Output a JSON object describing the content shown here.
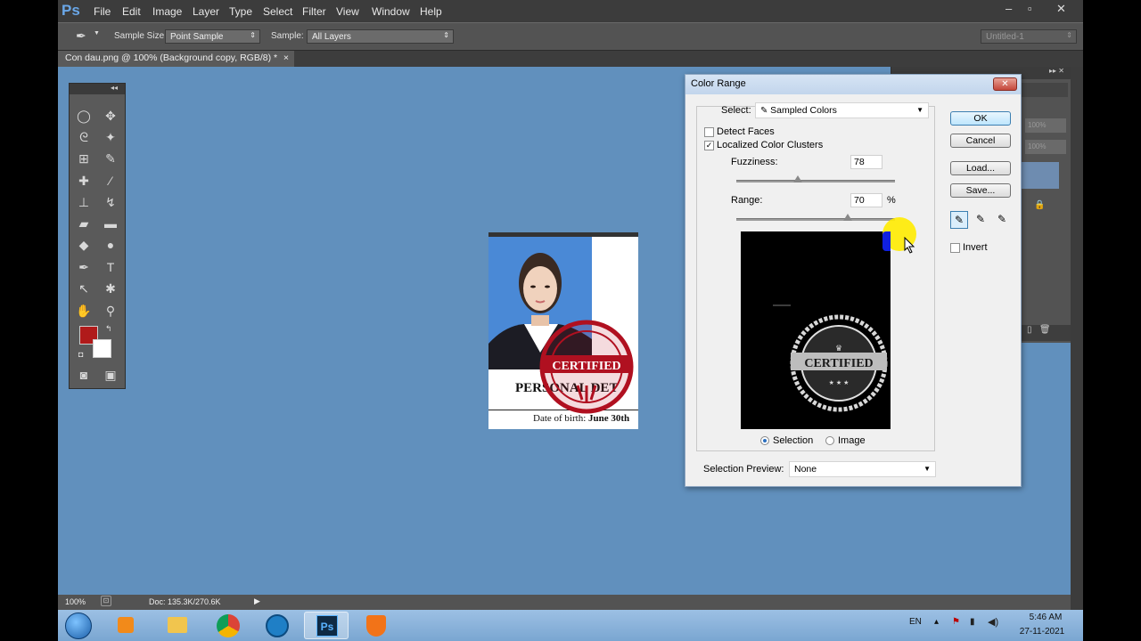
{
  "app": {
    "logo": "Ps",
    "menus": [
      "File",
      "Edit",
      "Image",
      "Layer",
      "Type",
      "Select",
      "Filter",
      "View",
      "Window",
      "Help"
    ],
    "window_controls": [
      "–",
      "▫",
      "✕"
    ]
  },
  "options_bar": {
    "sample_size_label": "Sample Size:",
    "sample_size_value": "Point Sample",
    "sample_label": "Sample:",
    "sample_value": "All Layers",
    "workspace_value": "Untitled-1"
  },
  "document_tab": {
    "title": "Con dau.png @ 100% (Background copy, RGB/8) *",
    "close": "×"
  },
  "document_image": {
    "heading": "PERSONAL DET",
    "dob_label": "Date of birth:",
    "dob_value": "June 30th",
    "stamp_text": "CERTIFIED"
  },
  "right_panel": {
    "zoom1": "100%",
    "zoom2": "100%"
  },
  "dialog": {
    "title": "Color Range",
    "close": "✕",
    "select_label": "Select:",
    "select_value": "Sampled Colors",
    "detect_faces": {
      "label": "Detect Faces",
      "checked": false
    },
    "localized_clusters": {
      "label": "Localized Color Clusters",
      "checked": true
    },
    "fuzziness_label": "Fuzziness:",
    "fuzziness_value": "78",
    "range_label": "Range:",
    "range_value": "70",
    "range_unit": "%",
    "preview_stamp_text": "CERTIFIED",
    "radio_selection": "Selection",
    "radio_image": "Image",
    "selection_preview_label": "Selection Preview:",
    "selection_preview_value": "None",
    "buttons": {
      "ok": "OK",
      "cancel": "Cancel",
      "load": "Load...",
      "save": "Save..."
    },
    "invert_label": "Invert"
  },
  "status_bar": {
    "zoom": "100%",
    "doc": "Doc: 135.3K/270.6K"
  },
  "taskbar": {
    "lang": "EN",
    "time": "5:46 AM",
    "date": "27-11-2021"
  },
  "colors": {
    "foreground": "#b01a1a",
    "background": "#ffffff",
    "canvas": "#6190bd"
  }
}
